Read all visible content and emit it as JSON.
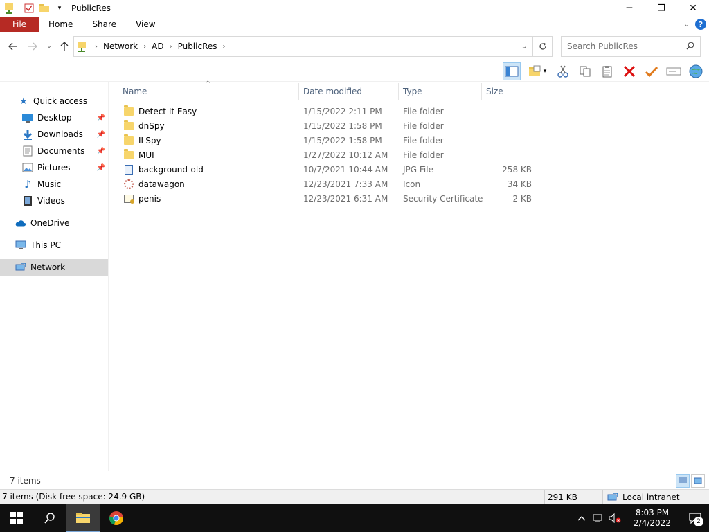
{
  "window": {
    "title": "PublicRes",
    "minimize": "─",
    "maximize": "❐",
    "close": "✕"
  },
  "ribbon": {
    "tabs": [
      {
        "label": "File"
      },
      {
        "label": "Home"
      },
      {
        "label": "Share"
      },
      {
        "label": "View"
      }
    ],
    "help": "?"
  },
  "address": {
    "crumbs": [
      "Network",
      "AD",
      "PublicRes"
    ],
    "search_placeholder": "Search PublicRes"
  },
  "nav": {
    "items": [
      {
        "label": "Quick access",
        "icon": "star-icon"
      },
      {
        "label": "Desktop",
        "icon": "desktop-icon",
        "pinned": true
      },
      {
        "label": "Downloads",
        "icon": "download-icon",
        "pinned": true
      },
      {
        "label": "Documents",
        "icon": "document-icon",
        "pinned": true
      },
      {
        "label": "Pictures",
        "icon": "pictures-icon",
        "pinned": true
      },
      {
        "label": "Music",
        "icon": "music-icon"
      },
      {
        "label": "Videos",
        "icon": "videos-icon"
      },
      {
        "label": "OneDrive",
        "icon": "cloud-icon"
      },
      {
        "label": "This PC",
        "icon": "computer-icon"
      },
      {
        "label": "Network",
        "icon": "network-icon",
        "selected": true
      }
    ]
  },
  "columns": {
    "name": "Name",
    "date": "Date modified",
    "type": "Type",
    "size": "Size"
  },
  "files": [
    {
      "name": "Detect It Easy",
      "date": "1/15/2022 2:11 PM",
      "type": "File folder",
      "size": "",
      "icon": "folder-icon"
    },
    {
      "name": "dnSpy",
      "date": "1/15/2022 1:58 PM",
      "type": "File folder",
      "size": "",
      "icon": "folder-icon"
    },
    {
      "name": "ILSpy",
      "date": "1/15/2022 1:58 PM",
      "type": "File folder",
      "size": "",
      "icon": "folder-icon"
    },
    {
      "name": "MUI",
      "date": "1/27/2022 10:12 AM",
      "type": "File folder",
      "size": "",
      "icon": "folder-icon"
    },
    {
      "name": "background-old",
      "date": "10/7/2021 10:44 AM",
      "type": "JPG File",
      "size": "258 KB",
      "icon": "jpg-file-icon"
    },
    {
      "name": "datawagon",
      "date": "12/23/2021 7:33 AM",
      "type": "Icon",
      "size": "34 KB",
      "icon": "ico-file-icon"
    },
    {
      "name": "penis",
      "date": "12/23/2021 6:31 AM",
      "type": "Security Certificate",
      "size": "2 KB",
      "icon": "certificate-file-icon"
    }
  ],
  "status": {
    "item_count": "7 items",
    "detail": "7 items (Disk free space: 24.9 GB)",
    "size": "291 KB",
    "zone": "Local intranet"
  },
  "taskbar": {
    "time": "8:03 PM",
    "date": "2/4/2022",
    "notification_count": "2"
  },
  "colors": {
    "file_tab": "#b62a24",
    "selection": "#cce4f7",
    "taskbar": "#101010"
  }
}
